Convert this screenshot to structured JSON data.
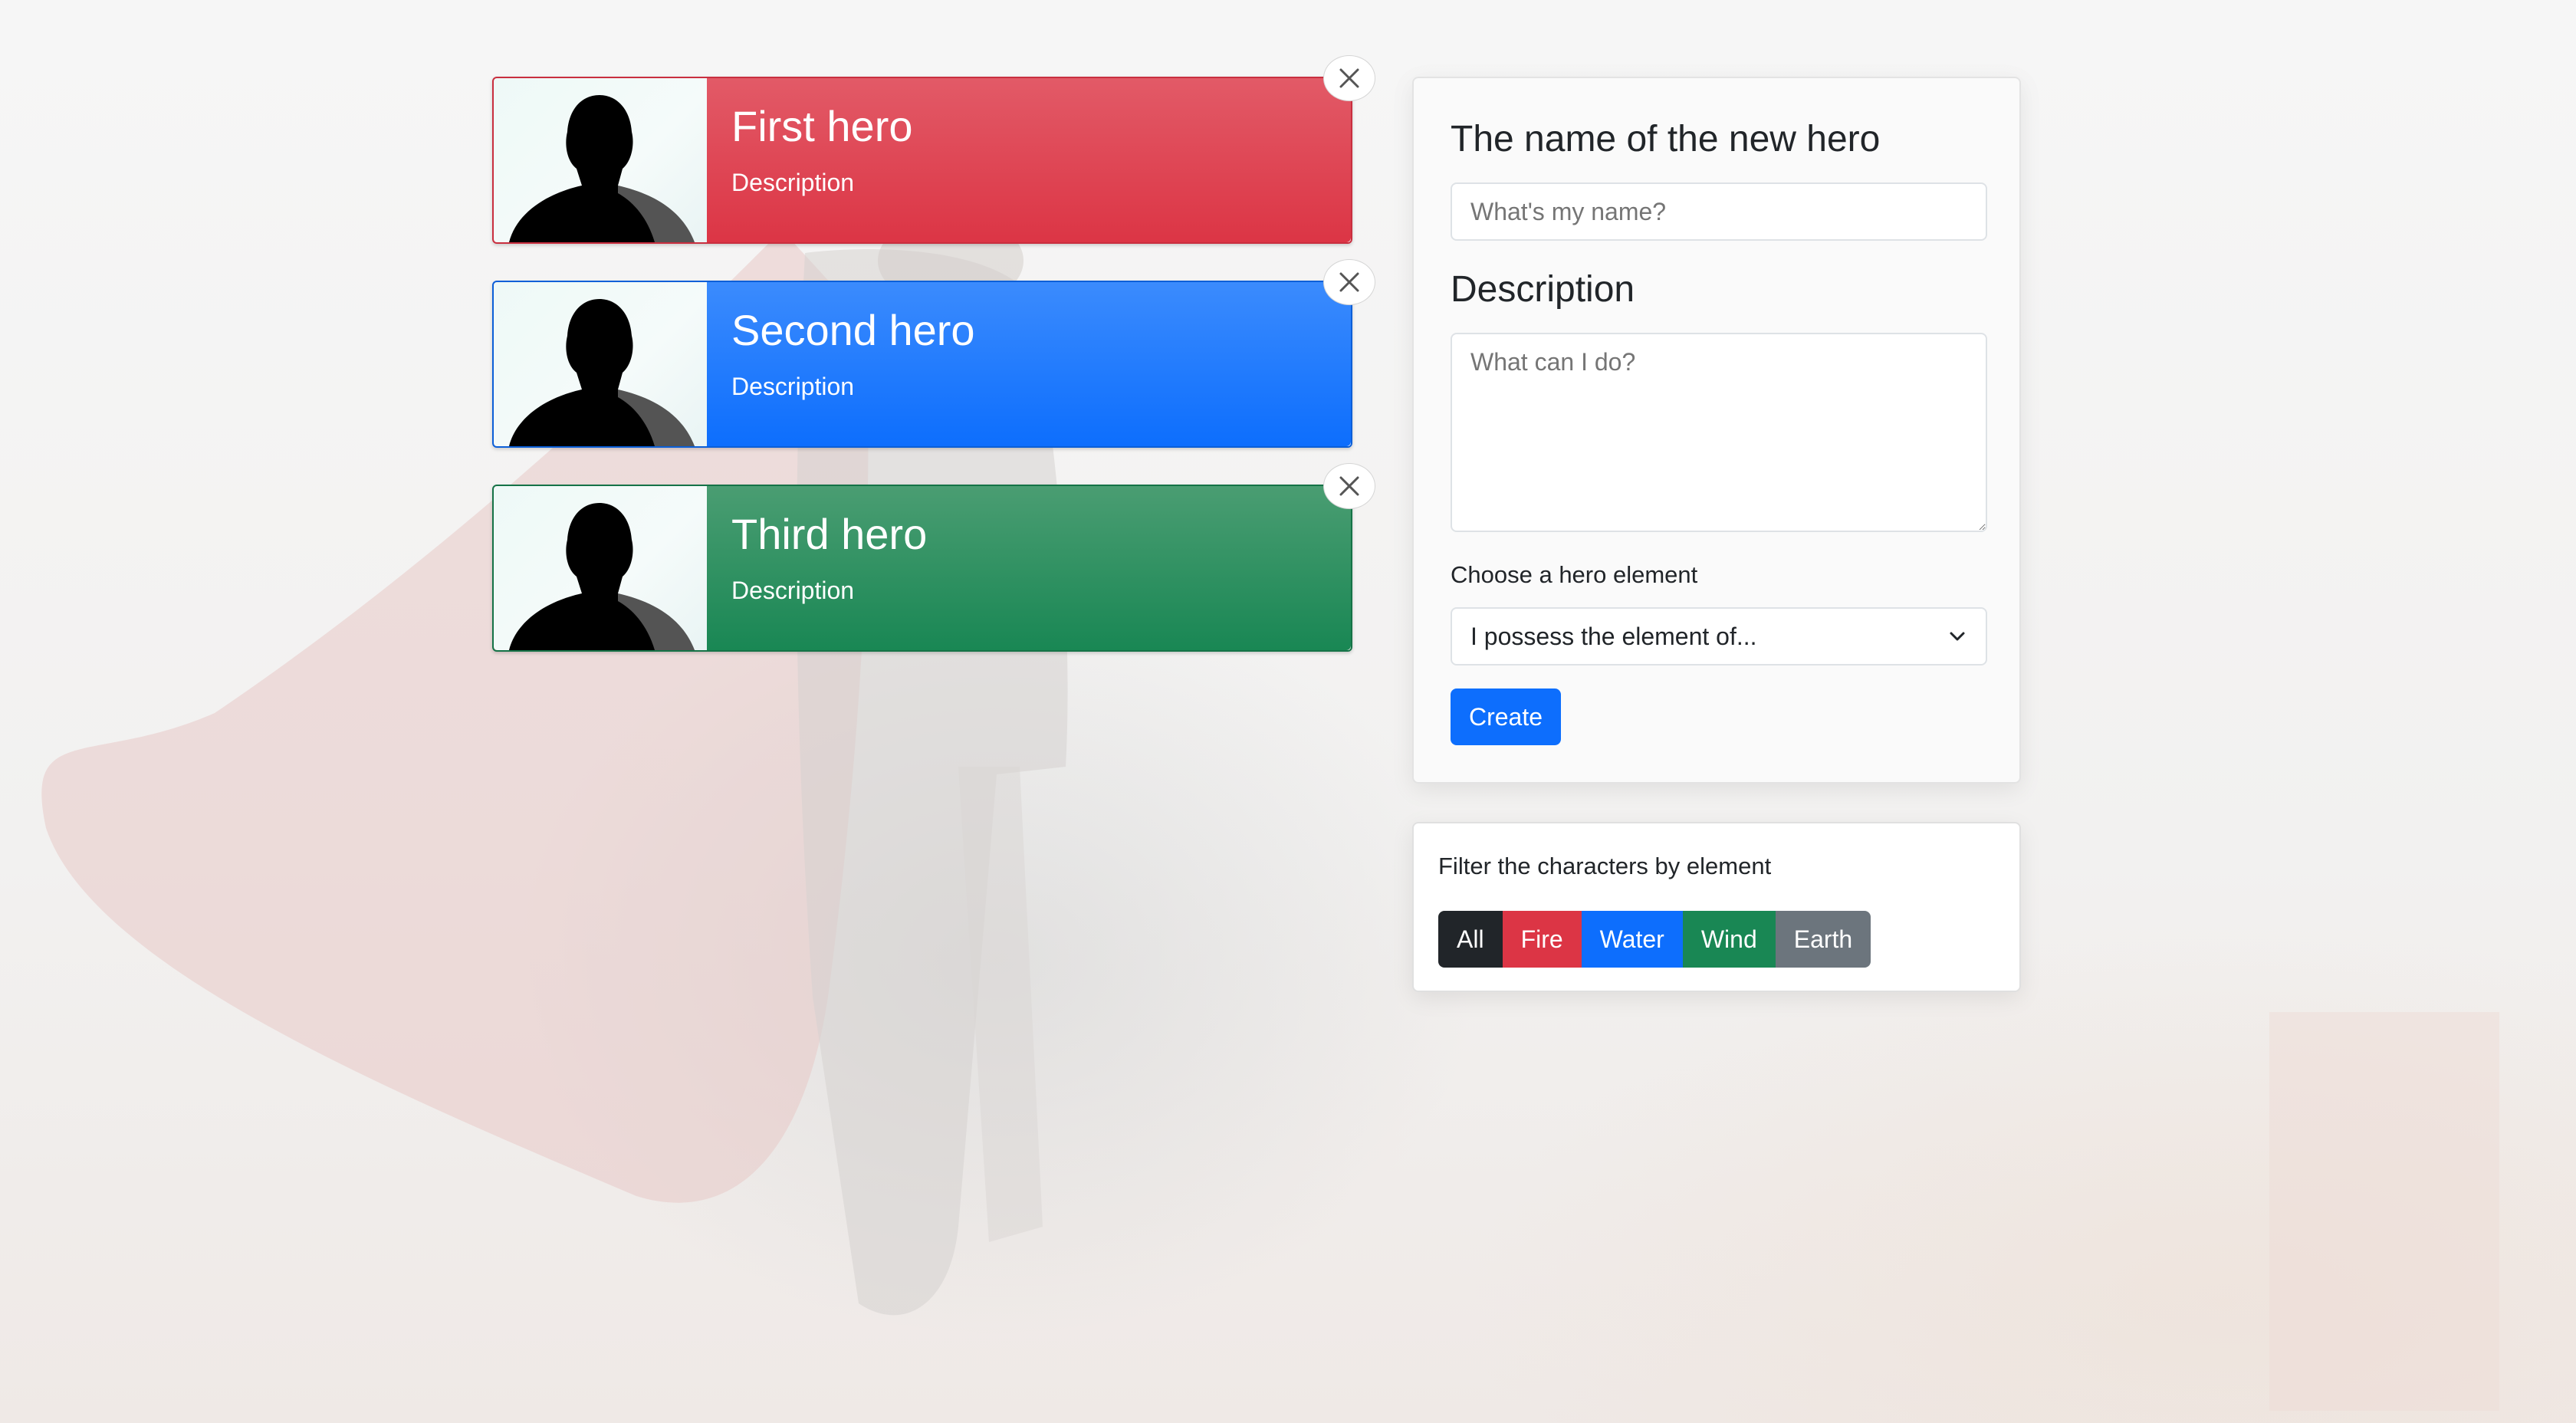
{
  "colors": {
    "fire": "#dc3545",
    "water": "#0d6efd",
    "wind": "#198754",
    "earth": "#6c757d",
    "all": "#212529"
  },
  "heroes": [
    {
      "name": "First hero",
      "description": "Description",
      "element_color": "fire",
      "close_icon": "close-icon"
    },
    {
      "name": "Second hero",
      "description": "Description",
      "element_color": "water",
      "close_icon": "close-icon"
    },
    {
      "name": "Third hero",
      "description": "Description",
      "element_color": "wind",
      "close_icon": "close-icon"
    }
  ],
  "form": {
    "name_heading": "The name of the new hero",
    "name_placeholder": "What's my name?",
    "description_heading": "Description",
    "description_placeholder": "What can I do?",
    "element_label": "Choose a hero element",
    "element_select_value": "I possess the element of...",
    "create_label": "Create"
  },
  "filter": {
    "label": "Filter the characters by element",
    "buttons": [
      "All",
      "Fire",
      "Water",
      "Wind",
      "Earth"
    ]
  }
}
